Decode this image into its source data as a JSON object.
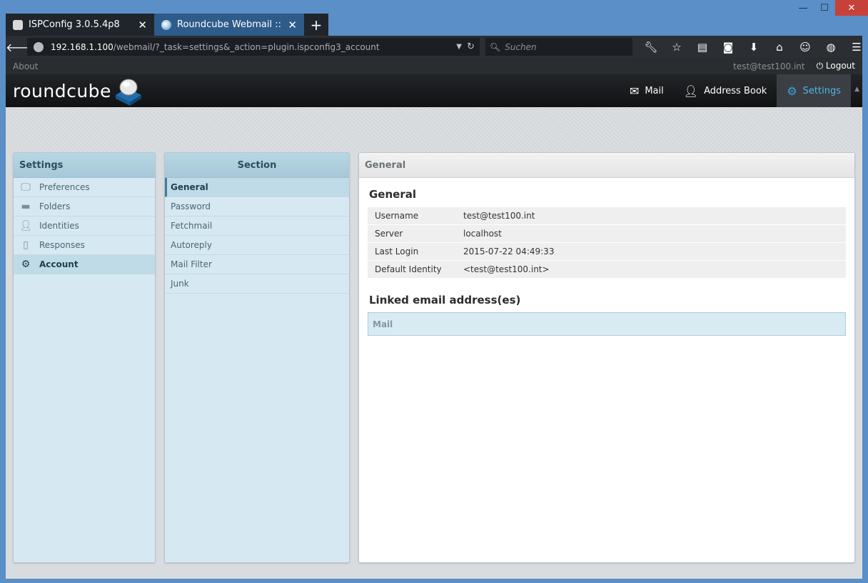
{
  "window": {
    "minimize": "—",
    "maximize": "☐",
    "close": "✕"
  },
  "tabs": [
    {
      "title": "ISPConfig 3.0.5.4p8",
      "active": false
    },
    {
      "title": "Roundcube Webmail :: Ac...",
      "active": true
    }
  ],
  "newtab": "+",
  "navbar": {
    "url_host": "192.168.1.100",
    "url_rest": "/webmail/?_task=settings&_action=plugin.ispconfig3_account",
    "search_placeholder": "Suchen"
  },
  "topline": {
    "about": "About",
    "user": "test@test100.int",
    "logout": "Logout"
  },
  "app": {
    "logo": "roundcube"
  },
  "topnav": [
    {
      "label": "Mail",
      "icon": "envelope-icon",
      "selected": false
    },
    {
      "label": "Address Book",
      "icon": "person-icon",
      "selected": false
    },
    {
      "label": "Settings",
      "icon": "gear-icon",
      "selected": true
    }
  ],
  "settings_panel": {
    "title": "Settings",
    "items": [
      {
        "label": "Preferences",
        "icon": "monitor-icon",
        "selected": false
      },
      {
        "label": "Folders",
        "icon": "folder-icon",
        "selected": false
      },
      {
        "label": "Identities",
        "icon": "person-icon",
        "selected": false
      },
      {
        "label": "Responses",
        "icon": "document-icon",
        "selected": false
      },
      {
        "label": "Account",
        "icon": "gear-icon",
        "selected": true
      }
    ]
  },
  "section_panel": {
    "title": "Section",
    "items": [
      {
        "label": "General",
        "selected": true
      },
      {
        "label": "Password",
        "selected": false
      },
      {
        "label": "Fetchmail",
        "selected": false
      },
      {
        "label": "Autoreply",
        "selected": false
      },
      {
        "label": "Mail Filter",
        "selected": false
      },
      {
        "label": "Junk",
        "selected": false
      }
    ]
  },
  "main": {
    "header": "General",
    "section_title": "General",
    "properties": [
      {
        "key": "Username",
        "value": "test@test100.int"
      },
      {
        "key": "Server",
        "value": "localhost"
      },
      {
        "key": "Last Login",
        "value": "2015-07-22 04:49:33"
      },
      {
        "key": "Default Identity",
        "value": "<test@test100.int>"
      }
    ],
    "linked_title": "Linked email address(es)",
    "linked_header": "Mail"
  },
  "colors": {
    "accent": "#37a6df",
    "panel_bg": "#d6e9f2",
    "selected_bg": "#c0dbe8"
  }
}
